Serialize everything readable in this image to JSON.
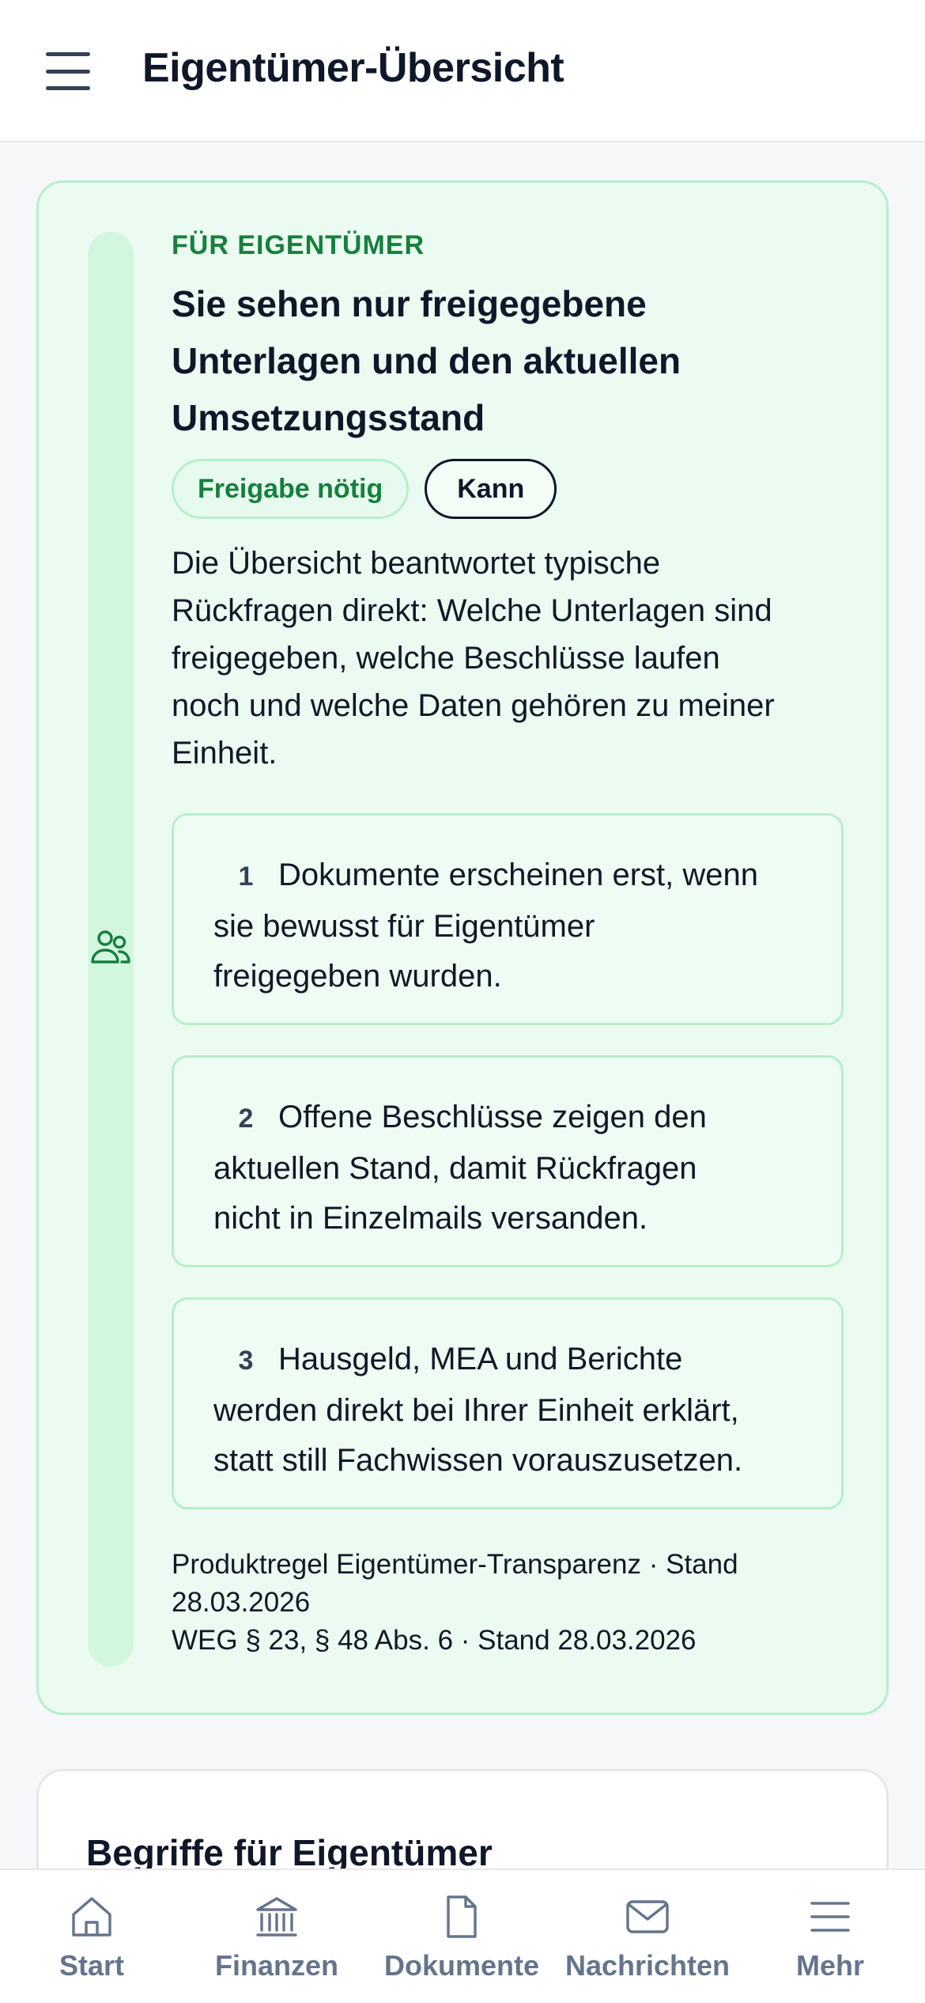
{
  "header": {
    "title": "Eigentümer-Übersicht",
    "menu_icon": "hamburger-menu-icon"
  },
  "info_card": {
    "eyebrow": "FÜR EIGENTÜMER",
    "title_lines": [
      "Sie sehen nur freigegebene",
      "Unterlagen und den aktuellen",
      "Umsetzungsstand"
    ],
    "icon": "users-icon",
    "chips": [
      {
        "label": "Freigabe nötig"
      },
      {
        "label": "Kann"
      }
    ],
    "description_lines": [
      "Die Übersicht beantwortet typische",
      "Rückfragen direkt: Welche Unterlagen sind",
      "freigegeben, welche Beschlüsse laufen",
      "noch und welche Daten gehören zu meiner",
      "Einheit."
    ],
    "steps": [
      {
        "number": "1",
        "lines": [
          "Dokumente erscheinen erst, wenn",
          "sie bewusst für Eigentümer",
          "freigegeben wurden."
        ]
      },
      {
        "number": "2",
        "lines": [
          "Offene Beschlüsse zeigen den",
          "aktuellen Stand, damit Rückfragen",
          "nicht in Einzelmails versanden."
        ]
      },
      {
        "number": "3",
        "lines": [
          "Hausgeld, MEA und Berichte",
          "werden direkt bei Ihrer Einheit erklärt,",
          "statt still Fachwissen vorauszusetzen."
        ]
      }
    ],
    "source_lines": [
      "Produktregel Eigentümer-Transparenz · Stand",
      "28.03.2026",
      "WEG § 23, § 48 Abs. 6 · Stand 28.03.2026"
    ]
  },
  "terms_card": {
    "title": "Begriffe für Eigentümer"
  },
  "bottom_nav": {
    "items": [
      {
        "label": "Start",
        "icon": "home-icon"
      },
      {
        "label": "Finanzen",
        "icon": "bank-icon"
      },
      {
        "label": "Dokumente",
        "icon": "document-icon"
      },
      {
        "label": "Nachrichten",
        "icon": "mail-icon"
      },
      {
        "label": "Mehr",
        "icon": "menu-icon"
      }
    ]
  },
  "colors": {
    "accent_green": "#15803d",
    "card_bg": "#ecfbf1",
    "card_border": "#b7efca",
    "nav_gray": "#64748b"
  }
}
